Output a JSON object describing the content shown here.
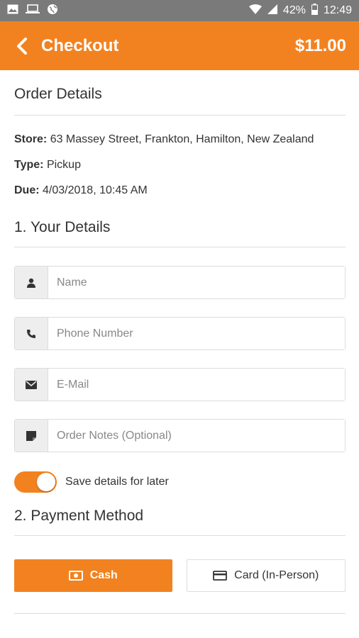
{
  "status_bar": {
    "battery": "42%",
    "time": "12:49"
  },
  "header": {
    "title": "Checkout",
    "total": "$11.00"
  },
  "order_details": {
    "heading": "Order Details",
    "store_label": "Store:",
    "store_value": "63 Massey Street, Frankton, Hamilton, New Zealand",
    "type_label": "Type:",
    "type_value": "Pickup",
    "due_label": "Due:",
    "due_value": "4/03/2018, 10:45 AM"
  },
  "your_details": {
    "heading": "1. Your Details",
    "name_placeholder": "Name",
    "phone_placeholder": "Phone Number",
    "email_placeholder": "E-Mail",
    "notes_placeholder": "Order Notes (Optional)",
    "save_label": "Save details for later"
  },
  "payment": {
    "heading": "2. Payment Method",
    "cash_label": "Cash",
    "card_label": "Card (In-Person)"
  },
  "colors": {
    "accent": "#f28220",
    "status_bar": "#7a7a7a"
  }
}
